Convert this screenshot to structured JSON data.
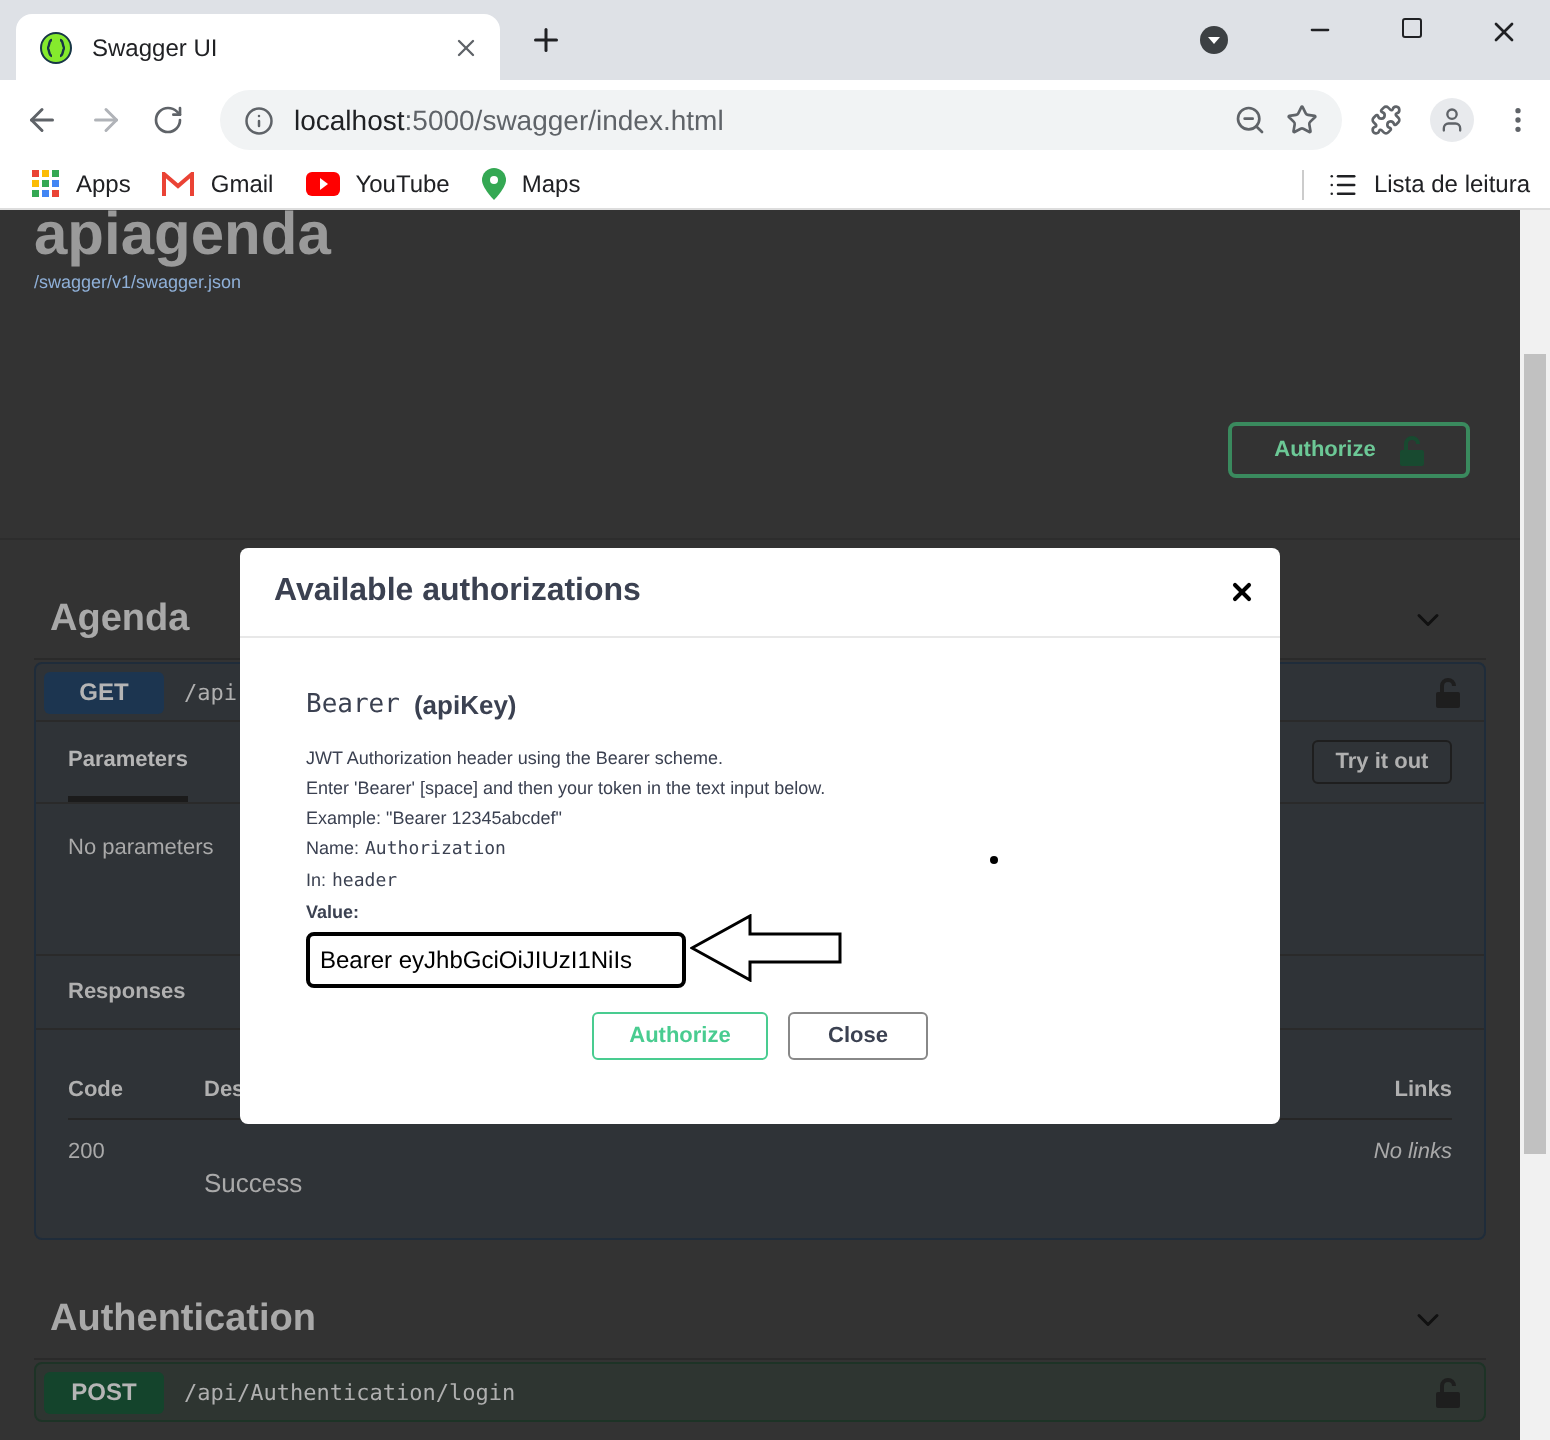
{
  "browser": {
    "tab": {
      "title": "Swagger UI"
    },
    "address": {
      "host": "localhost",
      "rest": ":5000/swagger/index.html"
    },
    "bookmarks": [
      {
        "label": "Apps",
        "kind": "apps"
      },
      {
        "label": "Gmail",
        "kind": "mail"
      },
      {
        "label": "YouTube",
        "kind": "video"
      },
      {
        "label": "Maps",
        "kind": "pin"
      }
    ],
    "reading_list": "Lista de leitura"
  },
  "page": {
    "title": "apiagenda",
    "spec_link": "/swagger/v1/swagger.json",
    "authorize_button": "Authorize",
    "sections": [
      {
        "name": "Agenda",
        "operations": [
          {
            "method": "GET",
            "color": "#1c3550",
            "path": "/api",
            "expanded": true,
            "tabs": [
              {
                "label": "Parameters",
                "selected": true
              }
            ],
            "try_button": "Try it out",
            "no_params": "No parameters",
            "responses_title": "Responses",
            "columns": [
              "Code",
              "Des",
              "Links"
            ],
            "rows": [
              {
                "code": "200",
                "description": "Success",
                "links": "No links"
              }
            ]
          }
        ]
      },
      {
        "name": "Authentication",
        "operations": [
          {
            "method": "POST",
            "color": "#14442c",
            "path": "/api/Authentication/login",
            "expanded": false
          }
        ]
      }
    ]
  },
  "dialog": {
    "title": "Available authorizations",
    "scheme_name": "Bearer",
    "scheme_type": "(apiKey)",
    "description": [
      "JWT Authorization header using the Bearer scheme.",
      "Enter 'Bearer' [space] and then your token in the text input below.",
      "Example: \"Bearer 12345abcdef\""
    ],
    "fields": [
      {
        "label": "Name:",
        "value": "Authorization"
      },
      {
        "label": "In:",
        "value": "header"
      }
    ],
    "value_label": "Value:",
    "value": "Bearer eyJhbGciOiJIUzI1NiIs",
    "buttons": [
      {
        "label": "Authorize",
        "kind": "primary"
      },
      {
        "label": "Close",
        "kind": "secondary"
      }
    ]
  }
}
